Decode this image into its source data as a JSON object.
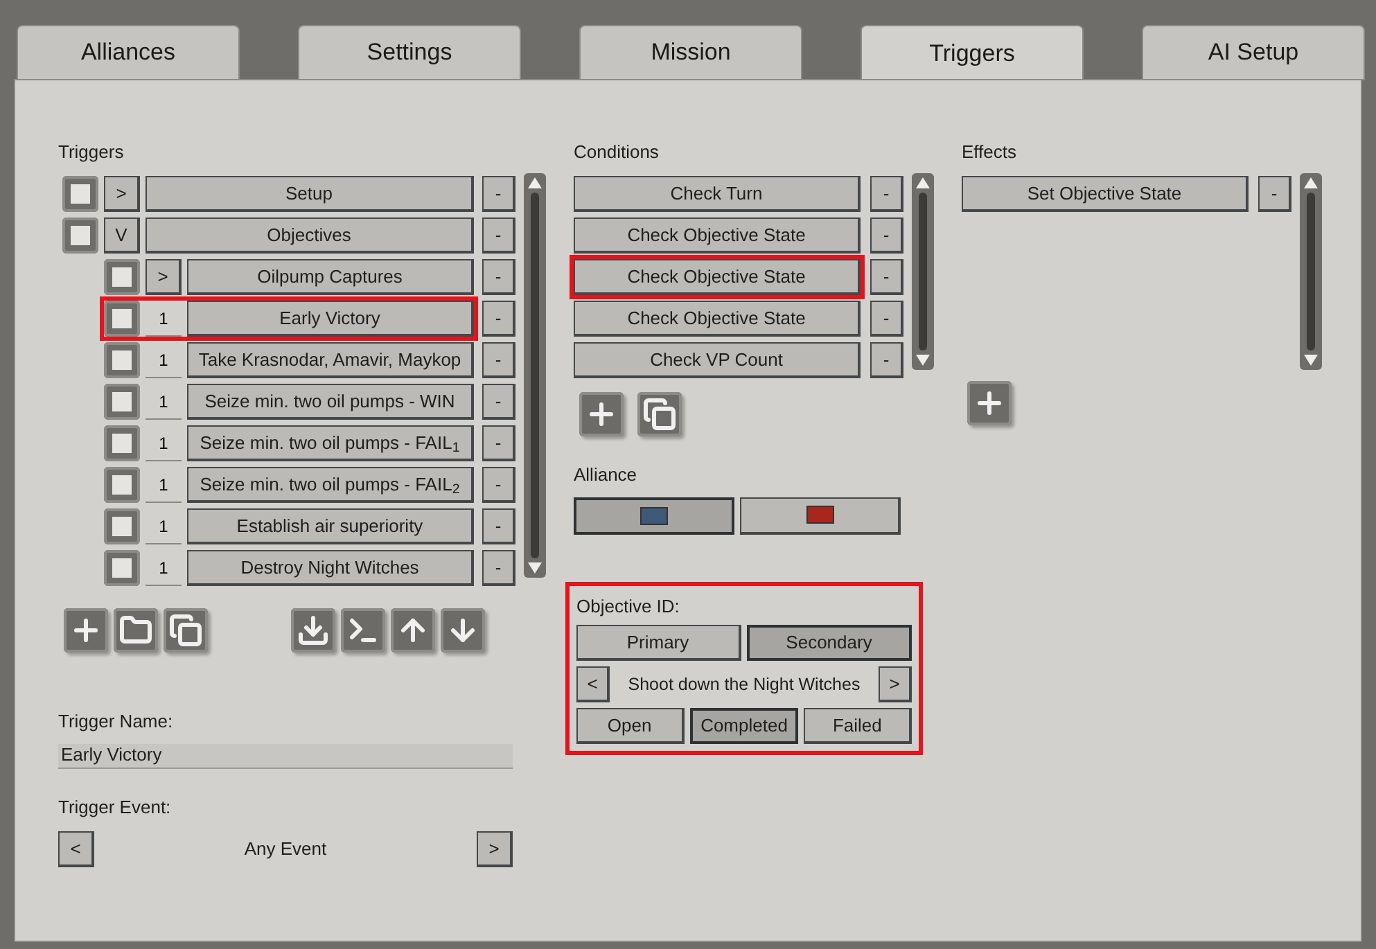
{
  "tabs": [
    {
      "label": "Alliances",
      "selected": false
    },
    {
      "label": "Settings",
      "selected": false
    },
    {
      "label": "Mission",
      "selected": false
    },
    {
      "label": "Triggers",
      "selected": true
    },
    {
      "label": "AI Setup",
      "selected": false
    }
  ],
  "triggers": {
    "heading": "Triggers",
    "items": [
      {
        "kind": "folder",
        "toggle": ">",
        "label": "Setup",
        "remove": "-",
        "highlighted": false
      },
      {
        "kind": "folder",
        "toggle": "V",
        "label": "Objectives",
        "remove": "-",
        "highlighted": false,
        "children": [
          {
            "kind": "folder",
            "toggle": ">",
            "label": "Oilpump Captures",
            "remove": "-",
            "highlighted": false
          },
          {
            "kind": "trigger",
            "count": "1",
            "label": "Early Victory",
            "remove": "-",
            "highlighted": true
          },
          {
            "kind": "trigger",
            "count": "1",
            "label": "Take Krasnodar, Amavir, Maykop",
            "remove": "-",
            "highlighted": false
          },
          {
            "kind": "trigger",
            "count": "1",
            "label": "Seize min. two oil pumps - WIN",
            "remove": "-",
            "highlighted": false
          },
          {
            "kind": "trigger",
            "count": "1",
            "label": "Seize min. two oil pumps - FAIL$_{1}$",
            "remove": "-",
            "highlighted": false
          },
          {
            "kind": "trigger",
            "count": "1",
            "label": "Seize min. two oil pumps - FAIL$_{2}$",
            "remove": "-",
            "highlighted": false
          },
          {
            "kind": "trigger",
            "count": "1",
            "label": "Establish air superiority",
            "remove": "-",
            "highlighted": false
          },
          {
            "kind": "trigger",
            "count": "1",
            "label": "Destroy Night Witches",
            "remove": "-",
            "highlighted": false
          }
        ]
      }
    ]
  },
  "trigger_name": {
    "label": "Trigger Name:",
    "value": "Early Victory"
  },
  "trigger_event": {
    "label": "Trigger Event:",
    "prev": "<",
    "value": "Any Event",
    "next": ">"
  },
  "conditions": {
    "heading": "Conditions",
    "items": [
      {
        "label": "Check Turn",
        "remove": "-",
        "highlighted": false
      },
      {
        "label": "Check Objective State",
        "remove": "-",
        "highlighted": false
      },
      {
        "label": "Check Objective State",
        "remove": "-",
        "highlighted": true
      },
      {
        "label": "Check Objective State",
        "remove": "-",
        "highlighted": false
      },
      {
        "label": "Check VP Count",
        "remove": "-",
        "highlighted": false
      }
    ]
  },
  "alliance": {
    "heading": "Alliance",
    "options": [
      {
        "color": "#3f5a78",
        "selected": true
      },
      {
        "color": "#a8261c",
        "selected": false
      }
    ]
  },
  "objective": {
    "highlighted": true,
    "heading": "Objective ID:",
    "types": [
      {
        "label": "Primary",
        "selected": false
      },
      {
        "label": "Secondary",
        "selected": true
      }
    ],
    "prev": "<",
    "value": "Shoot down the Night Witches",
    "next": ">",
    "states": [
      {
        "label": "Open",
        "selected": false
      },
      {
        "label": "Completed",
        "selected": true
      },
      {
        "label": "Failed",
        "selected": false
      }
    ]
  },
  "effects": {
    "heading": "Effects",
    "items": [
      {
        "label": "Set Objective State",
        "remove": "-",
        "highlighted": false
      }
    ]
  }
}
